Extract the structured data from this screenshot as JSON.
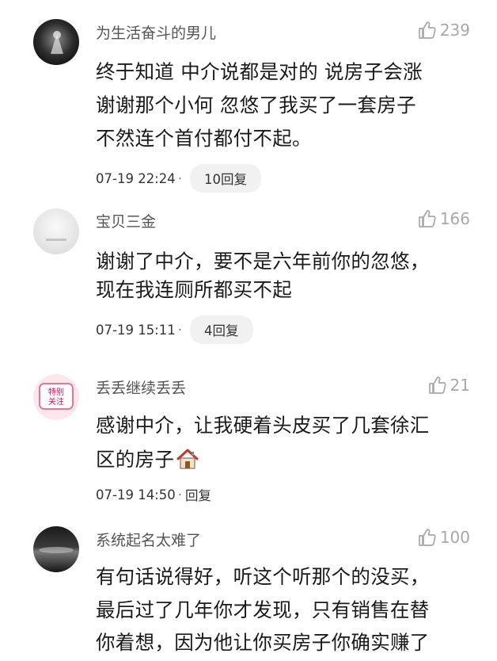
{
  "comments": [
    {
      "username": "为生活奋斗的男儿",
      "likes": "239",
      "lines": [
        "终于知道  中介说都是对的 说房子会涨",
        "谢谢那个小何  忽悠了我买了一套房子",
        "不然连个首付都付不起。"
      ],
      "timestamp": "07-19 22:24",
      "reply": "10回复"
    },
    {
      "username": "宝贝三金",
      "likes": "166",
      "lines": [
        "谢谢了中介，要不是六年前你的忽悠，",
        "现在我连厕所都买不起"
      ],
      "timestamp": "07-19 15:11",
      "reply": "4回复"
    },
    {
      "username": "丢丢继续丢丢",
      "likes": "21",
      "avatar_text": [
        "特别",
        "关注"
      ],
      "lines": [
        "感谢中介，让我硬着头皮买了几套徐汇",
        "区的房子"
      ],
      "timestamp": "07-19 14:50",
      "reply": "回复"
    },
    {
      "username": "系统起名太难了",
      "likes": "100",
      "lines": [
        "有句话说得好，听这个听那个的没买，",
        "最后过了几年你才发现，只有销售在替",
        "你着想，因为他让你买房子你确实赚了"
      ]
    }
  ],
  "colors": {
    "text": "#1a1a1a",
    "username": "#555555",
    "like": "#a8a8a8",
    "reply_pill": "#f1f1f1"
  },
  "icons": {
    "like": "thumbs-up-icon",
    "house": "house-emoji-icon"
  }
}
